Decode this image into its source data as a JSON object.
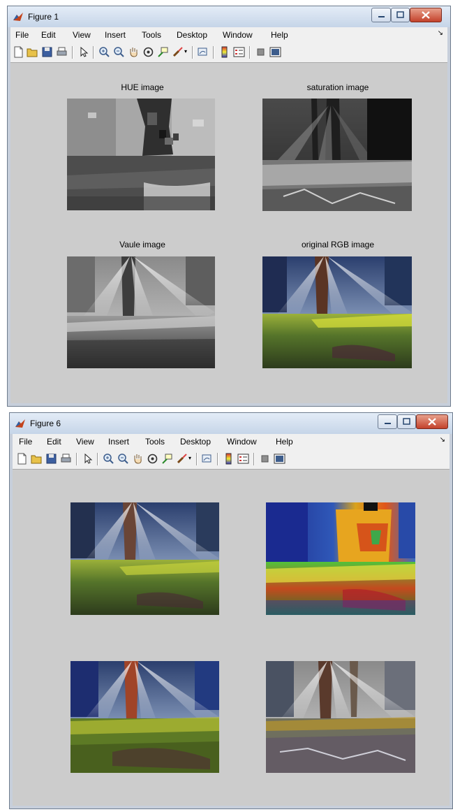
{
  "window1": {
    "title": "Figure 1",
    "menu": [
      "File",
      "Edit",
      "View",
      "Insert",
      "Tools",
      "Desktop",
      "Window",
      "Help"
    ],
    "plots": [
      {
        "title": "HUE image",
        "image": "hue-component-image"
      },
      {
        "title": "saturation image",
        "image": "saturation-component-image"
      },
      {
        "title": "Vaule image",
        "image": "value-component-image"
      },
      {
        "title": "original RGB  image",
        "image": "original-rgb-forest-image"
      }
    ]
  },
  "window2": {
    "title": "Figure 6",
    "menu": [
      "File",
      "Edit",
      "View",
      "Insert",
      "Tools",
      "Desktop",
      "Window",
      "Help"
    ],
    "plots": [
      {
        "image": "enhanced-forest-image"
      },
      {
        "image": "false-color-forest-image"
      },
      {
        "image": "saturated-forest-image"
      },
      {
        "image": "desaturated-forest-image"
      }
    ]
  },
  "toolbar_icons": [
    "new-file-icon",
    "open-folder-icon",
    "save-icon",
    "print-icon",
    "pointer-icon",
    "zoom-in-icon",
    "zoom-out-icon",
    "pan-hand-icon",
    "rotate-3d-icon",
    "data-cursor-icon",
    "brush-icon",
    "link-plot-icon",
    "colorbar-icon",
    "legend-icon",
    "hide-plot-tools-icon",
    "show-plot-tools-icon"
  ],
  "colors": {
    "figure_bg": "#cccccc",
    "menu_bg": "#f0f0f0",
    "title_bg": "#d7e3f1",
    "close_button": "#c3422b"
  }
}
